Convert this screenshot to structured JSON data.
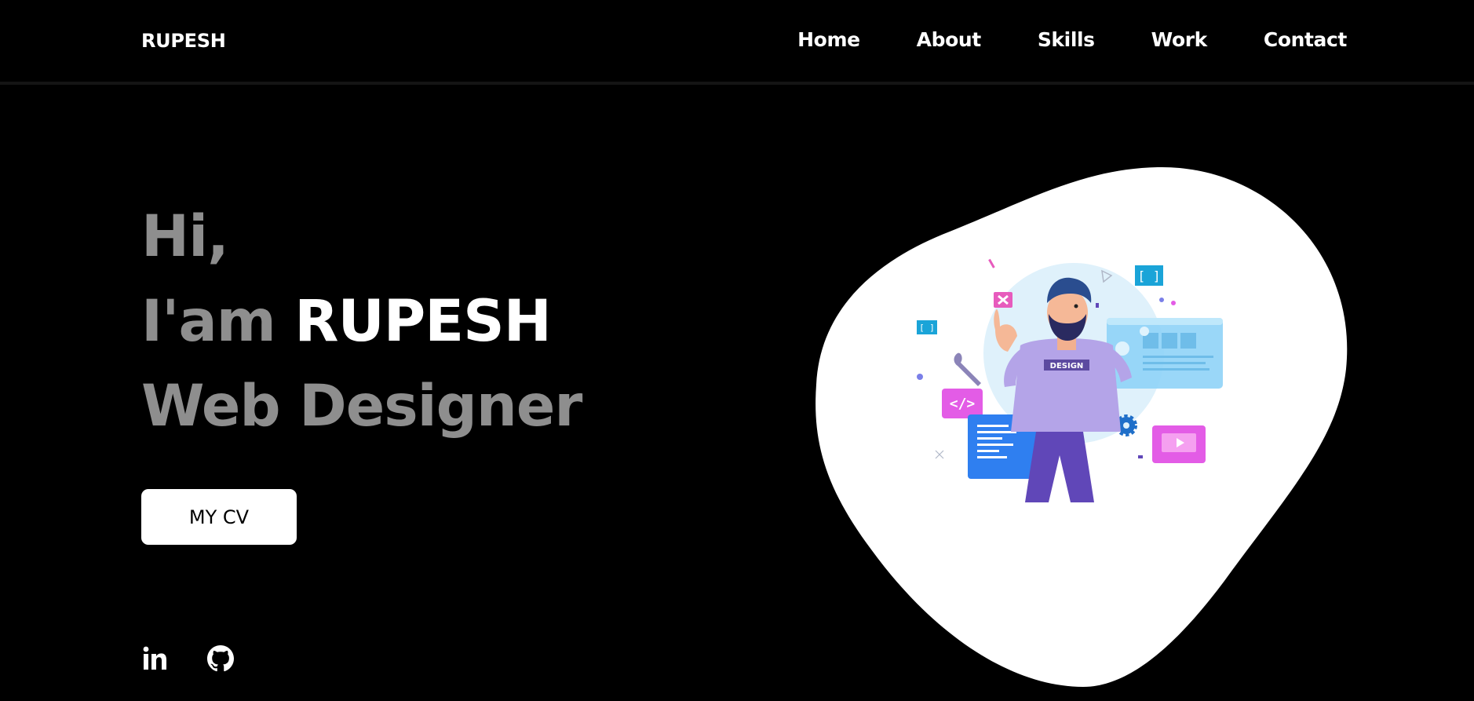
{
  "header": {
    "logo": "RUPESH",
    "nav": [
      "Home",
      "About",
      "Skills",
      "Work",
      "Contact"
    ]
  },
  "hero": {
    "greeting": "Hi,",
    "intro_prefix": "I'am",
    "name": "RUPESH",
    "role": "Web Designer",
    "cv_button": "MY CV"
  },
  "illustration": {
    "shirt_text": "DESIGN",
    "bracket_badge": "[ ]"
  },
  "social": {
    "icons": [
      "linkedin-icon",
      "github-icon"
    ]
  },
  "colors": {
    "background": "#000000",
    "muted_text": "#8e8e8e",
    "accent_white": "#ffffff",
    "blob": "#ffffff"
  }
}
